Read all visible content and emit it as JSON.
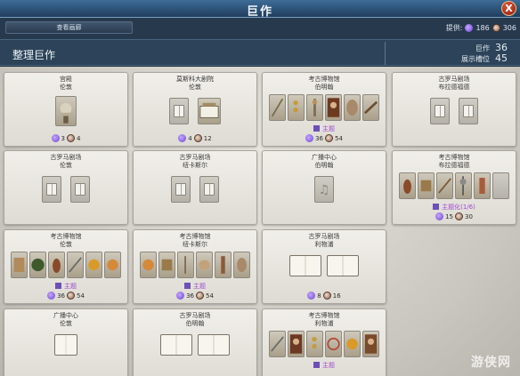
{
  "window": {
    "title": "巨作",
    "close": "X"
  },
  "top": {
    "gallery_button": "查看画廊",
    "provide_label": "提供:",
    "culture_value": "186",
    "tourism_value": "306"
  },
  "header": {
    "title": "整理巨作",
    "works_label": "巨作",
    "works_value": "36",
    "slots_label": "展示槽位",
    "slots_value": "45"
  },
  "cards": [
    {
      "name": "宫殿",
      "city": "伦敦",
      "culture": "3",
      "tourism": "4",
      "theme": ""
    },
    {
      "name": "莫斯科大剧院",
      "city": "伦敦",
      "culture": "4",
      "tourism": "12",
      "theme": ""
    },
    {
      "name": "考古博物馆",
      "city": "伯明翰",
      "culture": "36",
      "tourism": "54",
      "theme": "主题"
    },
    {
      "name": "古罗马剧场",
      "city": "布拉德福德",
      "culture": "",
      "tourism": "",
      "theme": ""
    },
    {
      "name": "古罗马剧场",
      "city": "伦敦",
      "culture": "",
      "tourism": "",
      "theme": ""
    },
    {
      "name": "古罗马剧场",
      "city": "纽卡斯尔",
      "culture": "",
      "tourism": "",
      "theme": ""
    },
    {
      "name": "广播中心",
      "city": "伯明翰",
      "culture": "",
      "tourism": "",
      "theme": ""
    },
    {
      "name": "考古博物馆",
      "city": "布拉德福德",
      "culture": "15",
      "tourism": "30",
      "theme": "主题化(1/6)"
    },
    {
      "name": "考古博物馆",
      "city": "伦敦",
      "culture": "36",
      "tourism": "54",
      "theme": "主题"
    },
    {
      "name": "考古博物馆",
      "city": "纽卡斯尔",
      "culture": "36",
      "tourism": "54",
      "theme": "主题"
    },
    {
      "name": "古罗马剧场",
      "city": "利物浦",
      "culture": "8",
      "tourism": "16",
      "theme": ""
    },
    {
      "name": "广播中心",
      "city": "伦敦",
      "culture": "",
      "tourism": "",
      "theme": ""
    },
    {
      "name": "古罗马剧场",
      "city": "伯明翰",
      "culture": "",
      "tourism": "",
      "theme": ""
    },
    {
      "name": "考古博物馆",
      "city": "利物浦",
      "culture": "",
      "tourism": "",
      "theme": "主题"
    }
  ],
  "watermark": "游侠网",
  "colors": {
    "theme_text": "#a04bd0",
    "title_bar": "#2f557c",
    "panel": "#e2e0da"
  }
}
